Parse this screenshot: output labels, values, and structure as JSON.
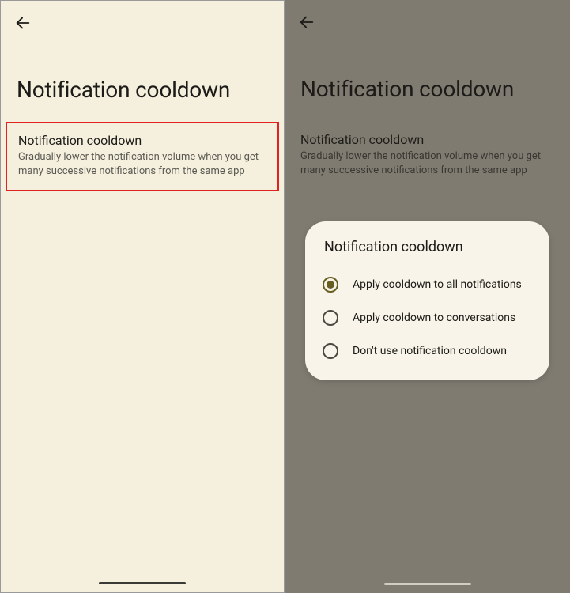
{
  "page_title": "Notification cooldown",
  "setting": {
    "title": "Notification cooldown",
    "description": "Gradually lower the notification volume when you get many successive notifications from the same app"
  },
  "dialog": {
    "title": "Notification cooldown",
    "options": [
      {
        "label": "Apply cooldown to all notifications",
        "checked": true
      },
      {
        "label": "Apply cooldown to conversations",
        "checked": false
      },
      {
        "label": "Don't use notification cooldown",
        "checked": false
      }
    ]
  }
}
